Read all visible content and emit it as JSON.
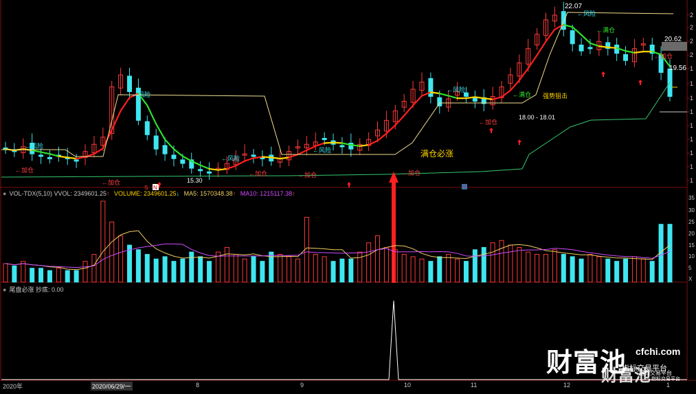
{
  "colors": {
    "up": "#ff3a3a",
    "down": "#3ee6f0",
    "ma_yellow": "#ffd400",
    "ma_green": "#2ee02e",
    "ma_red": "#ff2020",
    "risk_line": "#f0e090",
    "support_line": "#36c870",
    "vol_ma5": "#f0d060",
    "vol_ma10": "#d04cff",
    "arrow_red": "#ff2020",
    "text_cyan": "#3ee6f0",
    "text_yellow": "#ffd400",
    "text_green": "#2ee02e",
    "text_red": "#ff4040"
  },
  "price_panel": {
    "high_label": "22.07",
    "right_label_1": "20.62",
    "right_label_2": "19.56",
    "low_label": "15.30",
    "zone_label": "18.00 - 18.01",
    "strong_label": "强势狙击",
    "breakout_label": "满仓必涨",
    "marker_s": "S",
    "marker_n": "N",
    "tags": {
      "risk": "←风险",
      "add": "←加仓",
      "full": "←满仓"
    }
  },
  "volume_panel": {
    "title": "VOL-TDX(5,10) VVOL: 2349601.25",
    "vvol_arrow": "↑",
    "volume": "VOLUME: 2349601.25",
    "volume_arrow": "↓",
    "ma5": "MA5: 1570348.38",
    "ma5_arrow": "↑",
    "ma10": "MA10: 1215117.38",
    "ma10_arrow": "↑",
    "axis_labels": [
      "35",
      "30",
      "25",
      "20",
      "15",
      "10",
      "5",
      "X"
    ]
  },
  "signal_panel": {
    "title": "尾盘必涨 抄底: 0.00"
  },
  "x_axis": {
    "labels": [
      "2020年",
      "2020/06/29/一",
      "8",
      "9",
      "10",
      "11",
      "12",
      "1"
    ]
  },
  "watermark": {
    "big": "财富池",
    "domain": "cfchi.com",
    "sub": "指标交易平台",
    "big2": "财富池",
    "sub2": "指标交易平台",
    "sub3": "指标交易平台"
  },
  "price_right_ticks": [
    "2",
    "2",
    "2",
    "2",
    "1",
    "1",
    "1",
    "1",
    "1",
    "1",
    "1",
    "1",
    "1"
  ],
  "chart_data": {
    "type": "candlestick",
    "series_close": [
      16.4,
      16.3,
      16.5,
      16.2,
      16.1,
      16.0,
      16.1,
      16.0,
      15.9,
      16.3,
      16.6,
      16.9,
      19.0,
      19.5,
      18.8,
      17.6,
      17.0,
      16.4,
      16.2,
      16.0,
      15.8,
      15.6,
      15.5,
      15.4,
      15.6,
      15.8,
      16.0,
      16.2,
      16.1,
      16.0,
      15.9,
      16.0,
      16.3,
      16.5,
      16.6,
      16.7,
      16.8,
      16.6,
      16.5,
      16.4,
      16.6,
      16.8,
      17.2,
      17.6,
      18.0,
      18.4,
      18.9,
      19.2,
      18.6,
      18.2,
      18.5,
      18.8,
      18.6,
      18.4,
      18.3,
      18.6,
      19.0,
      19.5,
      20.0,
      20.6,
      21.2,
      21.8,
      22.0,
      21.4,
      20.8,
      20.5,
      20.6,
      20.9,
      20.6,
      20.4,
      20.1,
      20.6,
      20.8,
      20.4,
      19.6,
      18.6
    ],
    "volume_shape": [
      8,
      7,
      9,
      6,
      6,
      5,
      6,
      5,
      5,
      9,
      12,
      35,
      26,
      20,
      16,
      14,
      12,
      10,
      11,
      9,
      10,
      13,
      11,
      9,
      13,
      15,
      12,
      10,
      11,
      9,
      13,
      12,
      11,
      10,
      28,
      12,
      11,
      9,
      10,
      10,
      13,
      17,
      20,
      15,
      14,
      12,
      11,
      10,
      9,
      11,
      12,
      10,
      9,
      14,
      15,
      17,
      18,
      16,
      15,
      13,
      12,
      12,
      14,
      12,
      11,
      10,
      12,
      11,
      10,
      9,
      10,
      11,
      10,
      9,
      25,
      25
    ]
  }
}
